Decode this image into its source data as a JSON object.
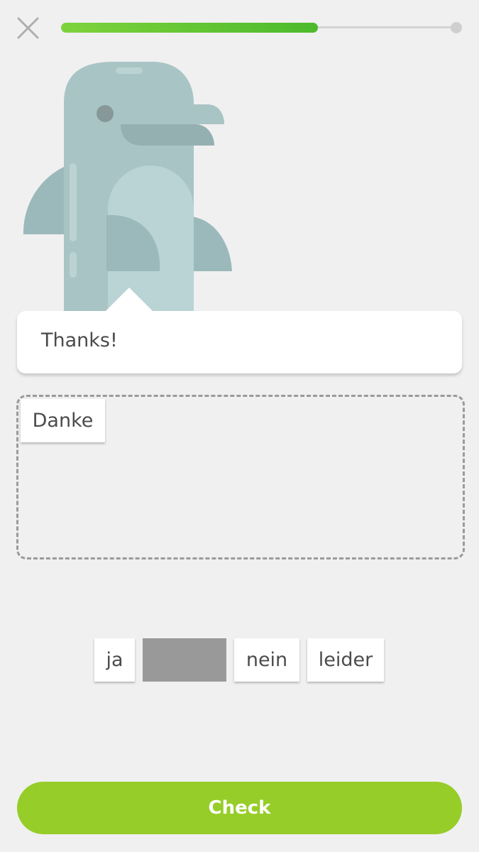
{
  "header": {
    "close_icon": "close-icon",
    "progress_fraction": 0.64
  },
  "prompt": {
    "text": "Thanks!"
  },
  "answer": {
    "selected_tiles": [
      "Danke"
    ]
  },
  "word_bank": {
    "tiles": [
      "ja",
      "",
      "nein",
      "leider"
    ]
  },
  "footer": {
    "check_label": "Check"
  },
  "colors": {
    "accent_green": "#96cd29",
    "progress_green": "#4cba2c",
    "background": "#f0f0f0",
    "mascot_body": "#a9c4c5"
  }
}
